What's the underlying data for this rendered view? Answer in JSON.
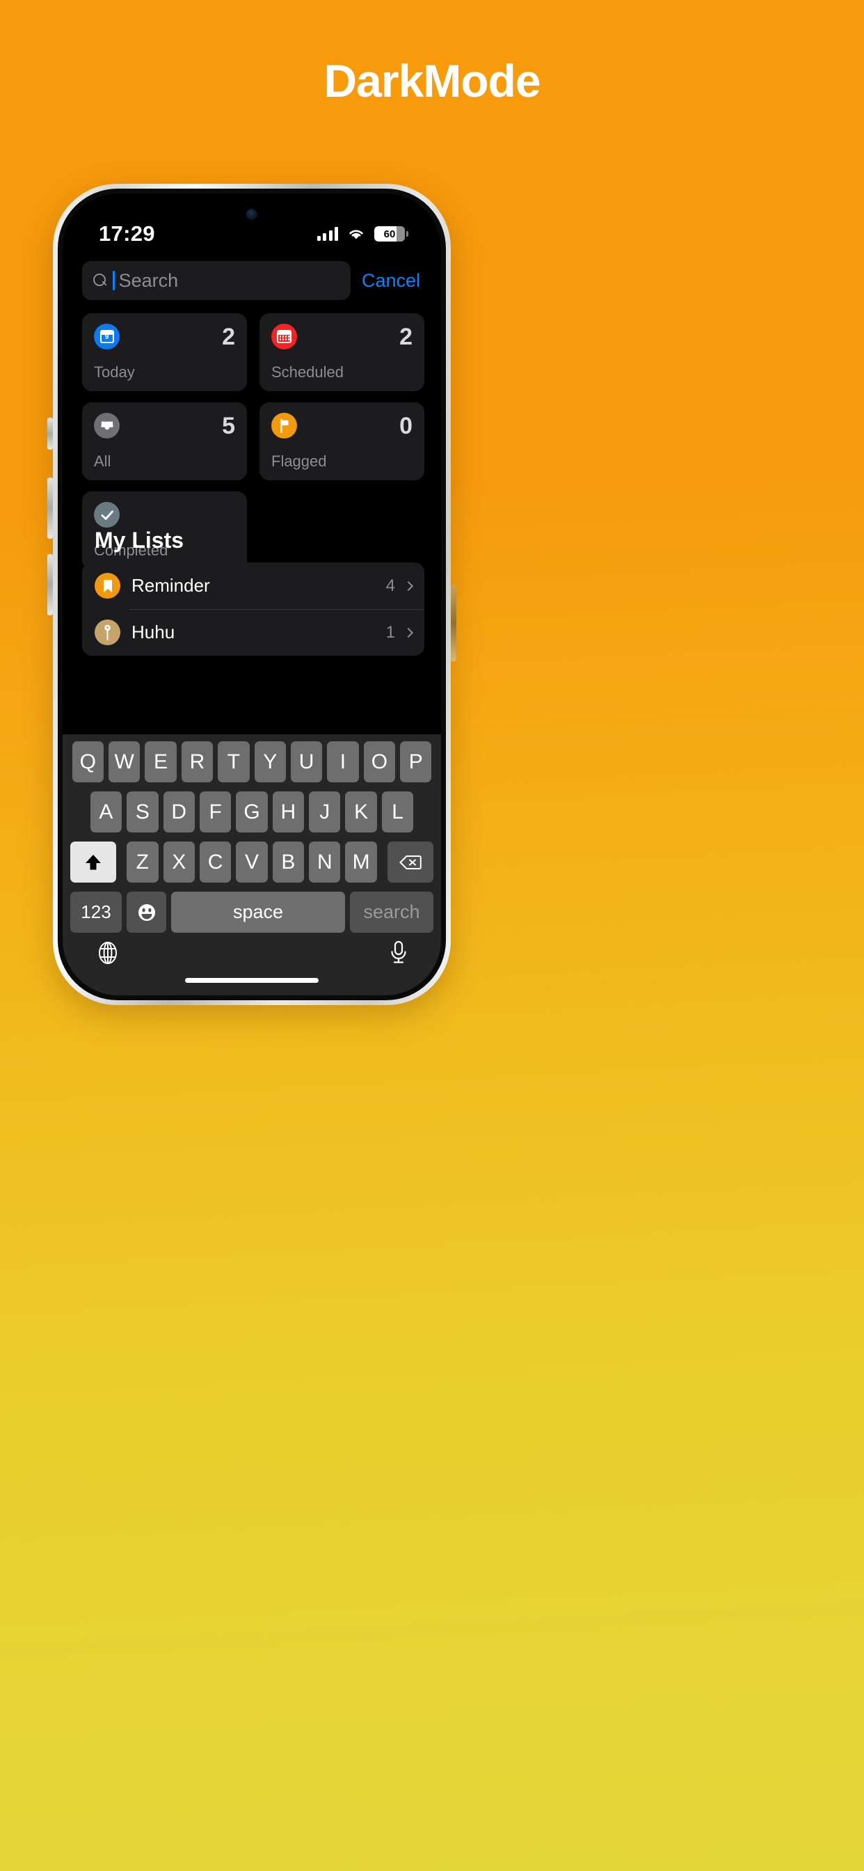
{
  "page": {
    "title": "DarkMode"
  },
  "status_bar": {
    "time": "17:29",
    "battery_percent": "60",
    "cellular_icon": "signal-bars-icon",
    "wifi_icon": "wifi-icon",
    "battery_icon": "battery-icon"
  },
  "search": {
    "placeholder": "Search",
    "value": "",
    "icon": "search-icon",
    "cancel_label": "Cancel"
  },
  "smart_cards": [
    {
      "label": "Today",
      "count": "2",
      "icon": "calendar-day-icon",
      "icon_color": "#0a7bf0",
      "day": "9"
    },
    {
      "label": "Scheduled",
      "count": "2",
      "icon": "calendar-icon",
      "icon_color": "#f72222"
    },
    {
      "label": "All",
      "count": "5",
      "icon": "inbox-tray-icon",
      "icon_color": "#6f6f74"
    },
    {
      "label": "Flagged",
      "count": "0",
      "icon": "flag-icon",
      "icon_color": "#f09a0e"
    },
    {
      "label": "Completed",
      "count": "",
      "icon": "checkmark-icon",
      "icon_color": "#697a82"
    }
  ],
  "my_lists": {
    "header": "My Lists",
    "rows": [
      {
        "name": "Reminder",
        "count": "4",
        "icon": "bookmark-icon",
        "icon_color": "#ef9a11"
      },
      {
        "name": "Huhu",
        "count": "1",
        "icon": "pin-icon",
        "icon_color": "#c6a36a"
      }
    ]
  },
  "keyboard": {
    "row1": [
      "Q",
      "W",
      "E",
      "R",
      "T",
      "Y",
      "U",
      "I",
      "O",
      "P"
    ],
    "row2": [
      "A",
      "S",
      "D",
      "F",
      "G",
      "H",
      "J",
      "K",
      "L"
    ],
    "row3": [
      "Z",
      "X",
      "C",
      "V",
      "B",
      "N",
      "M"
    ],
    "shift_icon": "shift-up-arrow-icon",
    "backspace_icon": "backspace-delete-icon",
    "numbers_label": "123",
    "emoji_icon": "emoji-smiley-icon",
    "space_label": "space",
    "return_label": "search",
    "globe_icon": "globe-language-icon",
    "mic_icon": "microphone-icon"
  }
}
